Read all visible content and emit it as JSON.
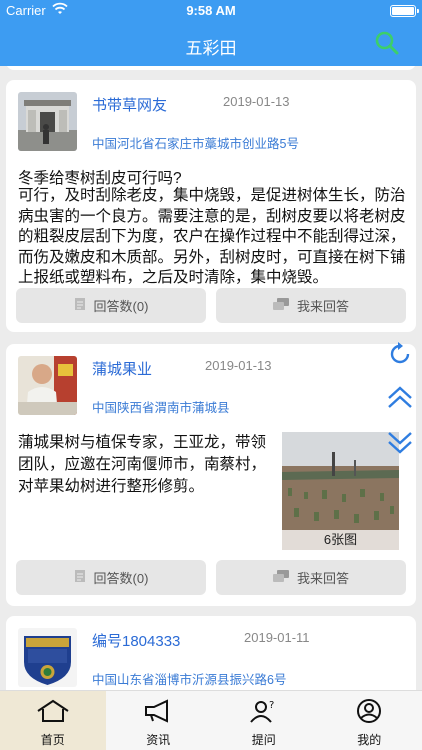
{
  "status": {
    "carrier": "Carrier",
    "time": "9:58 AM"
  },
  "nav": {
    "title": "五彩田",
    "search_icon": "search-icon"
  },
  "posts": [
    {
      "author": "书带草网友",
      "date": "2019-01-13",
      "location": "中国河北省石家庄市藁城市创业路5号",
      "title": "冬季给枣树刮皮可行吗?",
      "body": "可行，及时刮除老皮，集中烧毁，是促进树体生长，防治病虫害的一个良方。需要注意的是，刮树皮要以将老树皮的粗裂皮层刮下为度，农户在操作过程中不能刮得过深，而伤及嫩皮和木质部。另外，刮树皮时，可直接在树下铺上报纸或塑料布，之后及时清除，集中烧毁。",
      "answers_label": "回答数(0)",
      "reply_label": "我来回答"
    },
    {
      "author": "蒲城果业",
      "date": "2019-01-13",
      "location": "中国陕西省渭南市蒲城县",
      "body": "蒲城果树与植保专家，王亚龙，带领团队，应邀在河南偃师市，南蔡村，对苹果幼树进行整形修剪。",
      "image_count": "6张图",
      "answers_label": "回答数(0)",
      "reply_label": "我来回答"
    },
    {
      "author": "编号1804333",
      "date": "2019-01-11",
      "location": "中国山东省淄博市沂源县振兴路6号"
    }
  ],
  "floating": [
    "refresh-icon",
    "scroll-up-icon",
    "scroll-down-icon"
  ],
  "tabs": [
    {
      "label": "首页",
      "icon": "home-icon",
      "active": true
    },
    {
      "label": "资讯",
      "icon": "megaphone-icon",
      "active": false
    },
    {
      "label": "提问",
      "icon": "ask-person-icon",
      "active": false
    },
    {
      "label": "我的",
      "icon": "profile-icon",
      "active": false
    }
  ],
  "colors": {
    "primary": "#3d9cf2",
    "link": "#2b6bd6",
    "search_green": "#3ccf6a",
    "tab_active_bg": "#efe8d5"
  }
}
